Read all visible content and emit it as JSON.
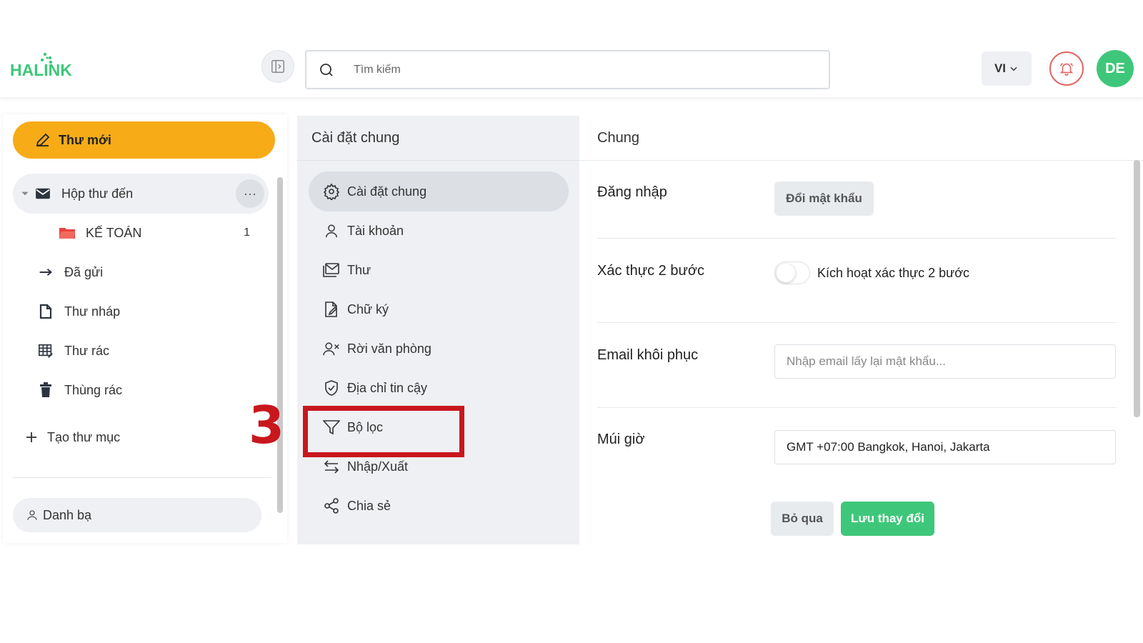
{
  "header": {
    "logo_text": "HALINK",
    "search_placeholder": "Tìm kiếm",
    "language": "VI",
    "avatar_initials": "DE"
  },
  "sidebar": {
    "new_mail_label": "Thư mới",
    "items": [
      {
        "label": "Hộp thư đến",
        "icon": "envelope-icon"
      },
      {
        "label": "KẾ TOÁN",
        "icon": "folder-icon",
        "count": "1"
      },
      {
        "label": "Đã gửi",
        "icon": "arrow-right-icon"
      },
      {
        "label": "Thư nháp",
        "icon": "document-icon"
      },
      {
        "label": "Thư rác",
        "icon": "spam-icon"
      },
      {
        "label": "Thùng rác",
        "icon": "trash-icon"
      }
    ],
    "create_folder_label": "Tạo thư mục",
    "contacts_label": "Danh bạ"
  },
  "settings": {
    "title": "Cài đặt chung",
    "items": [
      {
        "label": "Cài đặt chung",
        "icon": "gear-icon"
      },
      {
        "label": "Tài khoản",
        "icon": "user-icon"
      },
      {
        "label": "Thư",
        "icon": "mail-stack-icon"
      },
      {
        "label": "Chữ ký",
        "icon": "signature-icon"
      },
      {
        "label": "Rời văn phòng",
        "icon": "user-x-icon"
      },
      {
        "label": "Địa chỉ tin cậy",
        "icon": "shield-check-icon"
      },
      {
        "label": "Bộ lọc",
        "icon": "filter-icon"
      },
      {
        "label": "Nhập/Xuất",
        "icon": "swap-icon"
      },
      {
        "label": "Chia sẻ",
        "icon": "share-icon"
      }
    ]
  },
  "annotation": {
    "step": "3",
    "color": "#c8171d"
  },
  "content": {
    "title": "Chung",
    "login_label": "Đăng nhập",
    "change_password_label": "Đổi mật khẩu",
    "two_step_label": "Xác thực 2 bước",
    "two_step_toggle_label": "Kích hoạt xác thực 2 bước",
    "two_step_enabled": false,
    "recovery_email_label": "Email khôi phục",
    "recovery_email_placeholder": "Nhập email lấy lại mật khẩu...",
    "timezone_label": "Múi giờ",
    "timezone_value": "GMT +07:00 Bangkok, Hanoi, Jakarta",
    "cancel_label": "Bỏ qua",
    "save_label": "Lưu thay đổi"
  },
  "colors": {
    "accent_green": "#3ec77a",
    "new_mail_orange": "#f7ab17",
    "panel_gray": "#eef0f3"
  }
}
